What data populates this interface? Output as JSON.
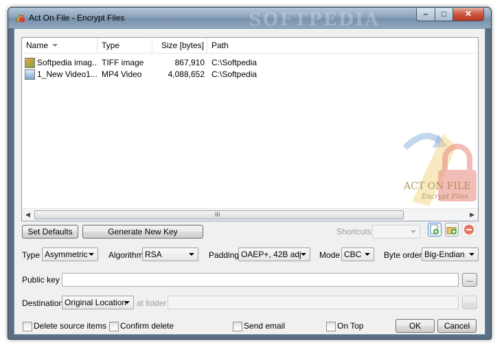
{
  "window": {
    "title": "Act On File - Encrypt Files",
    "watermark": "SOFTPEDIA"
  },
  "list": {
    "columns": [
      "Name",
      "Type",
      "Size [bytes]",
      "Path"
    ],
    "rows": [
      {
        "name": "Softpedia imag...",
        "type": "TIFF image",
        "size": "867,910",
        "path": "C:\\Softpedia",
        "icon": "tiff-file-icon"
      },
      {
        "name": "1_New Video1....",
        "type": "MP4 Video",
        "size": "4,088,652",
        "path": "C:\\Softpedia",
        "icon": "video-file-icon"
      }
    ],
    "logo_text_1": "ACT ON FILE",
    "logo_text_2": "Encrypt Files",
    "scroll_grip": "III"
  },
  "buttons": {
    "set_defaults": "Set Defaults",
    "generate_key": "Generate New Key",
    "ok": "OK",
    "cancel": "Cancel",
    "browse": "..."
  },
  "shortcuts": {
    "label": "Shortcuts",
    "value": ""
  },
  "options": {
    "type_label": "Type",
    "type_value": "Asymmetric",
    "algorithm_label": "Algorithm",
    "algorithm_value": "RSA",
    "padding_label": "Padding",
    "padding_value": "OAEP+, 42B adj",
    "mode_label": "Mode",
    "mode_value": "CBC",
    "byte_order_label": "Byte order",
    "byte_order_value": "Big-Endian"
  },
  "public_key": {
    "label": "Public key",
    "value": ""
  },
  "destination": {
    "label": "Destination",
    "value": "Original Location",
    "at_folder_label": "at folder",
    "folder_value": ""
  },
  "checkboxes": {
    "delete_source": "Delete source items",
    "confirm_delete": "Confirm delete",
    "send_email": "Send email",
    "on_top": "On Top"
  },
  "colors": {
    "accent": "#5a6f84",
    "close_button": "#c9543b",
    "logo_red": "#d83a2e"
  }
}
